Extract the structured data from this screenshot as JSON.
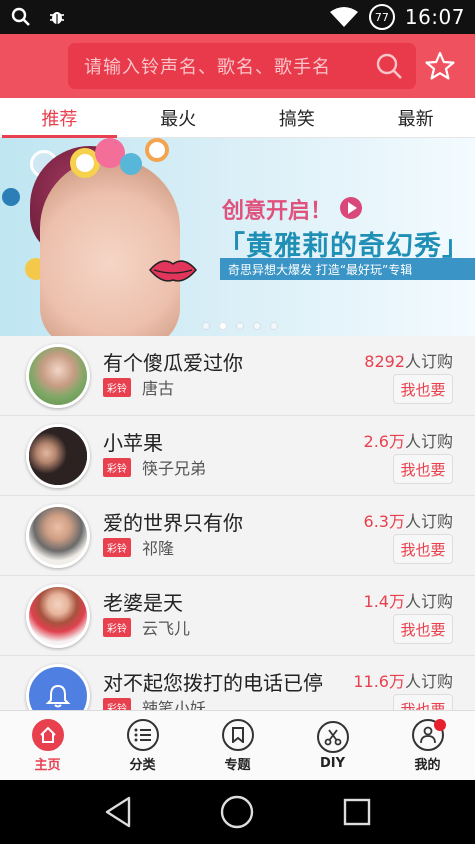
{
  "status_bar": {
    "time": "16:07",
    "battery": "77",
    "icons": [
      "search-icon",
      "bug-icon",
      "wifi-icon",
      "battery-icon"
    ]
  },
  "header": {
    "search_placeholder": "请输入铃声名、歌名、歌手名",
    "star_icon": "star-icon",
    "accent": "#f0515e"
  },
  "tabs": [
    {
      "label": "推荐",
      "active": true
    },
    {
      "label": "最火",
      "active": false
    },
    {
      "label": "搞笑",
      "active": false
    },
    {
      "label": "最新",
      "active": false
    }
  ],
  "banner": {
    "line1": "创意开启！",
    "line2": "「黄雅莉的奇幻秀」",
    "line3": "奇思异想大爆发 打造“最好玩”专辑",
    "active_dot": 1,
    "dot_count": 5
  },
  "list": [
    {
      "song": "有个傻瓜爱过你",
      "tag": "彩铃",
      "artist": "唐古",
      "count": "8292",
      "unit": "人订购",
      "button": "我也要",
      "avatar_color": "#8ab36a"
    },
    {
      "song": "小苹果",
      "tag": "彩铃",
      "artist": "筷子兄弟",
      "count": "2.6万",
      "unit": "人订购",
      "button": "我也要",
      "avatar_color": "#3a2a2a"
    },
    {
      "song": "爱的世界只有你",
      "tag": "彩铃",
      "artist": "祁隆",
      "count": "6.3万",
      "unit": "人订购",
      "button": "我也要",
      "avatar_color": "#cfc4b6"
    },
    {
      "song": "老婆是天",
      "tag": "彩铃",
      "artist": "云飞儿",
      "count": "1.4万",
      "unit": "人订购",
      "button": "我也要",
      "avatar_color": "#e0414e"
    },
    {
      "song": "对不起您拨打的电话已停",
      "tag": "彩铃",
      "artist": "辣笔小妖",
      "count": "11.6万",
      "unit": "人订购",
      "button": "我也要",
      "avatar_color": "#4f7fe0"
    }
  ],
  "bottom_nav": [
    {
      "label": "主页",
      "icon": "home-icon",
      "active": true
    },
    {
      "label": "分类",
      "icon": "list-icon",
      "active": false
    },
    {
      "label": "专题",
      "icon": "bookmark-icon",
      "active": false
    },
    {
      "label": "DIY",
      "icon": "scissors-icon",
      "active": false
    },
    {
      "label": "我的",
      "icon": "person-icon",
      "active": false,
      "badge": true
    }
  ],
  "system_nav": [
    "back-icon",
    "home-circle-icon",
    "recents-icon"
  ]
}
